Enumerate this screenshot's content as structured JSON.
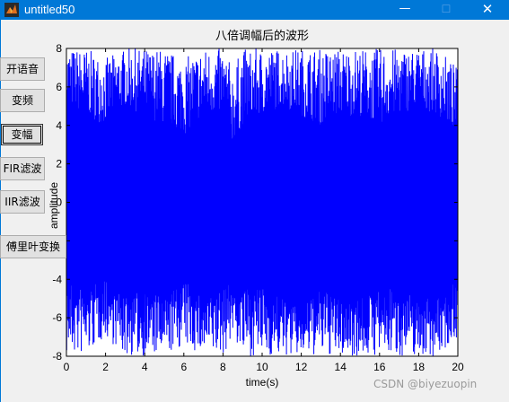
{
  "window": {
    "title": "untitled50",
    "minimize_glyph": "—",
    "maximize_glyph": "☐",
    "close_glyph": "✕",
    "titlebar_color": "#0078d7"
  },
  "buttons": [
    {
      "label": "开语音"
    },
    {
      "label": "变频"
    },
    {
      "label": "变幅"
    },
    {
      "label": "FIR滤波"
    },
    {
      "label": "IIR滤波"
    },
    {
      "label": "傅里叶变换"
    }
  ],
  "watermark": "CSDN @biyezuopin",
  "chart_data": {
    "type": "line",
    "title": "八倍调幅后的波形",
    "xlabel": "time(s)",
    "ylabel": "amplitude",
    "xlim": [
      0,
      20
    ],
    "ylim": [
      -8,
      8
    ],
    "xticks": [
      "0",
      "2",
      "4",
      "6",
      "8",
      "10",
      "12",
      "14",
      "16",
      "18",
      "20"
    ],
    "yticks": [
      "8",
      "6",
      "4",
      "2",
      "0",
      "-2",
      "-4",
      "-6",
      "-8"
    ],
    "grid": false,
    "series": [
      {
        "color": "#0000ff",
        "envelope_x": [
          0,
          1,
          2,
          3,
          4,
          5,
          6,
          7,
          8,
          8.5,
          9,
          10,
          11,
          12,
          13,
          14,
          15,
          16,
          17,
          18,
          19,
          20
        ],
        "envelope_upper": [
          8,
          8,
          7.5,
          8,
          8,
          8,
          7.5,
          8,
          8,
          7,
          8,
          8,
          8,
          8,
          8,
          8,
          8,
          8,
          8,
          8,
          8,
          7
        ],
        "envelope_lower": [
          -8,
          -8,
          -7,
          -8,
          -8,
          -8,
          -7.5,
          -8,
          -8,
          -7,
          -8,
          -8,
          -8,
          -8,
          -8,
          -8,
          -8,
          -8,
          -8,
          -8,
          -8,
          -7
        ],
        "dense_band_upper": [
          5,
          4.5,
          4,
          5,
          4.5,
          4,
          3.5,
          4.5,
          4.5,
          3,
          4,
          4.5,
          5,
          4.5,
          4,
          4.5,
          4.5,
          4,
          4.5,
          5,
          4.5,
          3.5
        ],
        "dense_band_lower": [
          -4,
          -4.5,
          -4,
          -5,
          -4.5,
          -5,
          -4,
          -5,
          -4.5,
          -4,
          -4.5,
          -4.5,
          -5,
          -5.5,
          -4.5,
          -5,
          -5,
          -4.5,
          -4.5,
          -5,
          -5,
          -4
        ]
      }
    ]
  }
}
